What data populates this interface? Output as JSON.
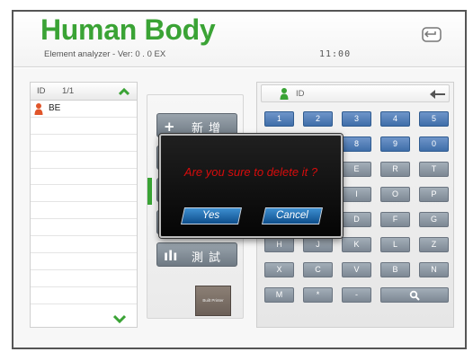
{
  "header": {
    "title": "Human Body",
    "subtitle": "Element analyzer - Ver: 0 . 0 EX",
    "time": "11:00",
    "exit_icon": "exit-icon"
  },
  "user_list": {
    "header_id": "ID",
    "page_indicator": "1/1",
    "items": [
      {
        "name": "BE",
        "icon": "person-icon",
        "icon_color": "#e0552a"
      }
    ]
  },
  "menu": {
    "new": {
      "icon": "+",
      "label": "新增"
    },
    "test": {
      "icon": "ılı",
      "label": "測試"
    },
    "printer_label": "Built Printer"
  },
  "keyboard": {
    "input_placeholder": "ID",
    "row1": [
      "1",
      "2",
      "3",
      "4",
      "5"
    ],
    "row2": [
      "8",
      "9",
      "0"
    ],
    "row3": [
      "E",
      "R",
      "T"
    ],
    "row4": [
      "I",
      "O",
      "P"
    ],
    "row5": [
      "D",
      "F",
      "G"
    ],
    "row6": [
      "H",
      "J",
      "K",
      "L",
      "Z"
    ],
    "row7": [
      "X",
      "C",
      "V",
      "B",
      "N"
    ],
    "row8": [
      "M",
      "*",
      "-"
    ],
    "search_icon": "search-icon"
  },
  "dialog": {
    "message": "Are you sure to delete it ?",
    "yes_label": "Yes",
    "cancel_label": "Cancel"
  },
  "colors": {
    "brand_green": "#3aa335",
    "dialog_text": "#d80c0c",
    "key_blue": "#3f6ea9",
    "key_gray": "#7d8894"
  }
}
